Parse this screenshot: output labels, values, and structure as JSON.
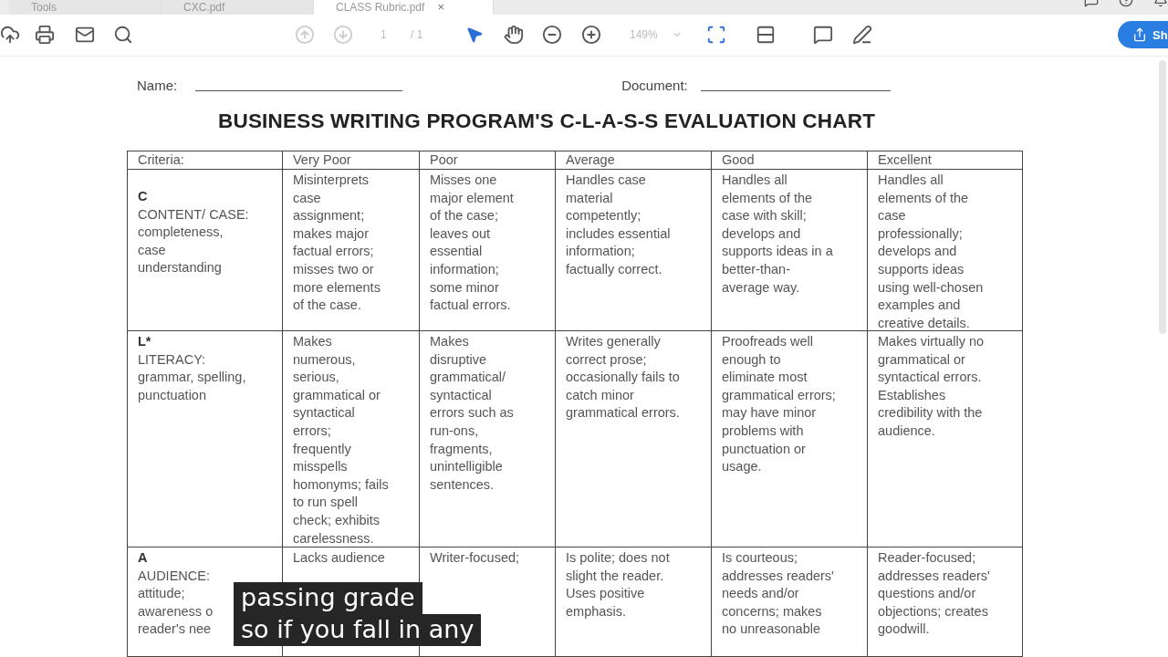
{
  "tabs": [
    {
      "label": "Tools",
      "selected": false
    },
    {
      "label": "CXC.pdf",
      "selected": false
    },
    {
      "label": "CLASS Rubric.pdf",
      "selected": true,
      "close": "×"
    }
  ],
  "toolbar": {
    "page": "1",
    "page_count": "/ 1",
    "zoom": "149%",
    "share": "Sh"
  },
  "document": {
    "name_label": "Name:",
    "document_label": "Document:",
    "title": "BUSINESS WRITING PROGRAM'S C-L-A-S-S EVALUATION CHART",
    "criteria_header": "Criteria:",
    "columns": [
      "Very Poor",
      "Poor",
      "Average",
      "Good",
      "Excellent"
    ],
    "rows": [
      {
        "letter": "C",
        "criteria": "CONTENT/ CASE:\ncompleteness,\ncase\nunderstanding",
        "cells": [
          "Misinterprets\ncase\nassignment;\nmakes major\nfactual errors;\nmisses two or\nmore elements\nof the case.",
          "Misses one\nmajor element\nof the case;\nleaves out\nessential\ninformation;\nsome minor\nfactual errors.",
          "Handles case\nmaterial\ncompetently;\nincludes essential\ninformation;\nfactually correct.",
          "Handles all\nelements of the\ncase with skill;\ndevelops and\nsupports ideas in a\nbetter-than-\naverage way.",
          "Handles all\nelements of the\ncase\nprofessionally;\ndevelops and\nsupports ideas\nusing well-chosen\nexamples and\ncreative details."
        ]
      },
      {
        "letter": "L*",
        "criteria": "LITERACY:\ngrammar, spelling,\npunctuation",
        "cells": [
          "Makes\nnumerous,\nserious,\ngrammatical or\nsyntactical\nerrors;\nfrequently\nmisspells\nhomonyms; fails\nto run spell\ncheck; exhibits\ncarelessness.",
          "Makes\ndisruptive\ngrammatical/\nsyntactical\nerrors such as\nrun-ons,\nfragments,\nunintelligible\nsentences.",
          "Writes generally\ncorrect prose;\noccasionally fails to\ncatch minor\ngrammatical errors.",
          "Proofreads well\nenough to\neliminate most\ngrammatical errors;\nmay have minor\nproblems with\npunctuation or\nusage.",
          "Makes virtually no\ngrammatical or\nsyntactical errors.\nEstablishes\ncredibility with the\naudience."
        ]
      },
      {
        "letter": "A",
        "criteria": "AUDIENCE:\nattitude;\nawareness o\nreader's nee",
        "cells": [
          "Lacks audience",
          "Writer-focused;",
          "Is polite; does not\nslight the reader.\nUses positive\nemphasis.",
          "Is courteous;\naddresses readers'\nneeds and/or\nconcerns; makes\nno unreasonable",
          "Reader-focused;\naddresses readers'\nquestions and/or\nobjections; creates\ngoodwill."
        ]
      }
    ]
  },
  "captions": [
    "passing grade",
    "so if you fall in any"
  ]
}
